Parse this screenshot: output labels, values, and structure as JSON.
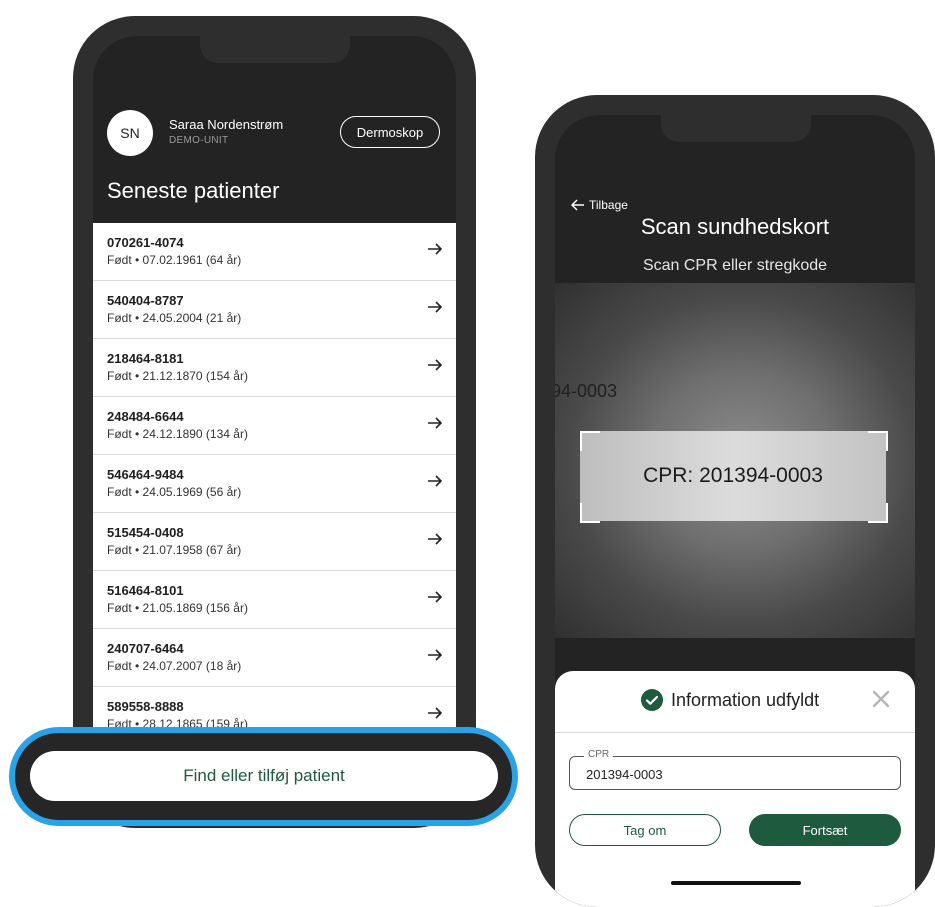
{
  "left_phone": {
    "user": {
      "initials": "SN",
      "name": "Saraa Nordenstrøm",
      "unit": "DEMO-UNIT"
    },
    "dermoscope_label": "Dermoskop",
    "title": "Seneste patienter",
    "patients": [
      {
        "cpr": "070261-4074",
        "born": "Født • 07.02.1961 (64 år)"
      },
      {
        "cpr": "540404-8787",
        "born": "Født • 24.05.2004 (21 år)"
      },
      {
        "cpr": "218464-8181",
        "born": "Født • 21.12.1870 (154 år)"
      },
      {
        "cpr": "248484-6644",
        "born": "Født • 24.12.1890 (134 år)"
      },
      {
        "cpr": "546464-9484",
        "born": "Født • 24.05.1969 (56 år)"
      },
      {
        "cpr": "515454-0408",
        "born": "Født • 21.07.1958 (67 år)"
      },
      {
        "cpr": "516464-8101",
        "born": "Født • 21.05.1869 (156 år)"
      },
      {
        "cpr": "240707-6464",
        "born": "Født • 24.07.2007 (18 år)"
      },
      {
        "cpr": "589558-8888",
        "born": "Født • 28.12.1865 (159 år)"
      }
    ],
    "find_button": "Find eller tilføj patient"
  },
  "right_phone": {
    "back_label": "Tilbage",
    "title": "Scan sundhedskort",
    "subtitle": "Scan CPR eller stregkode",
    "camera": {
      "partial_text": "94-0003",
      "card_text": "CPR: 201394-0003"
    },
    "sheet": {
      "title": "Information udfyldt",
      "field_label": "CPR",
      "field_value": "201394-0003",
      "retake_label": "Tag om",
      "continue_label": "Fortsæt"
    }
  },
  "colors": {
    "accent_green": "#1e5a3e",
    "highlight_blue": "#2aa3e6",
    "dark_bg": "#232323"
  }
}
